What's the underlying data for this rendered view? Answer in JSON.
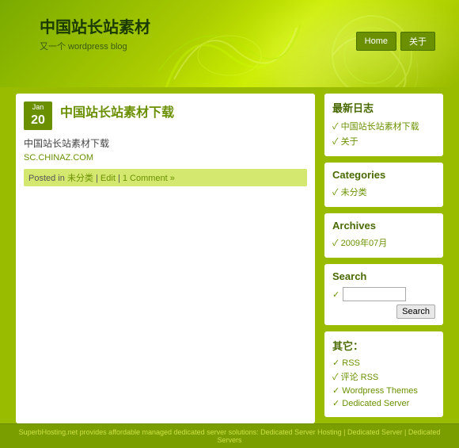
{
  "header": {
    "site_title": "中国站长站素材",
    "site_subtitle": "又一个 wordpress blog",
    "nav": {
      "home_label": "Home",
      "about_label": "关于"
    }
  },
  "post": {
    "date_month": "Jan",
    "date_day": "20",
    "title": "中国站长站素材下载",
    "excerpt": "中国站长站素材下载",
    "link": "SC.CHINAZ.COM",
    "meta_prefix": "Posted in",
    "category": "未分类",
    "edit_label": "Edit",
    "comment": "1 Comment »"
  },
  "sidebar": {
    "recent_posts_title": "最新日志",
    "recent_posts": [
      {
        "label": "中国站长站素材下载"
      },
      {
        "label": "关于"
      }
    ],
    "categories_title": "Categories",
    "categories": [
      {
        "label": "未分类"
      }
    ],
    "archives_title": "Archives",
    "archives": [
      {
        "label": "2009年07月"
      }
    ],
    "search_title": "Search",
    "search_placeholder": "",
    "search_btn_label": "Search",
    "other_title": "其它：",
    "other_links": [
      {
        "label": "RSS"
      },
      {
        "label": "评论 RSS"
      },
      {
        "label": "Wordpress Themes"
      },
      {
        "label": "Dedicated Server"
      }
    ]
  },
  "footer": {
    "text": "SuperbHosting.net provides affordable managed dedicated server solutions: Dedicated Server Hosting | Dedicated Server | Dedicated Servers"
  }
}
